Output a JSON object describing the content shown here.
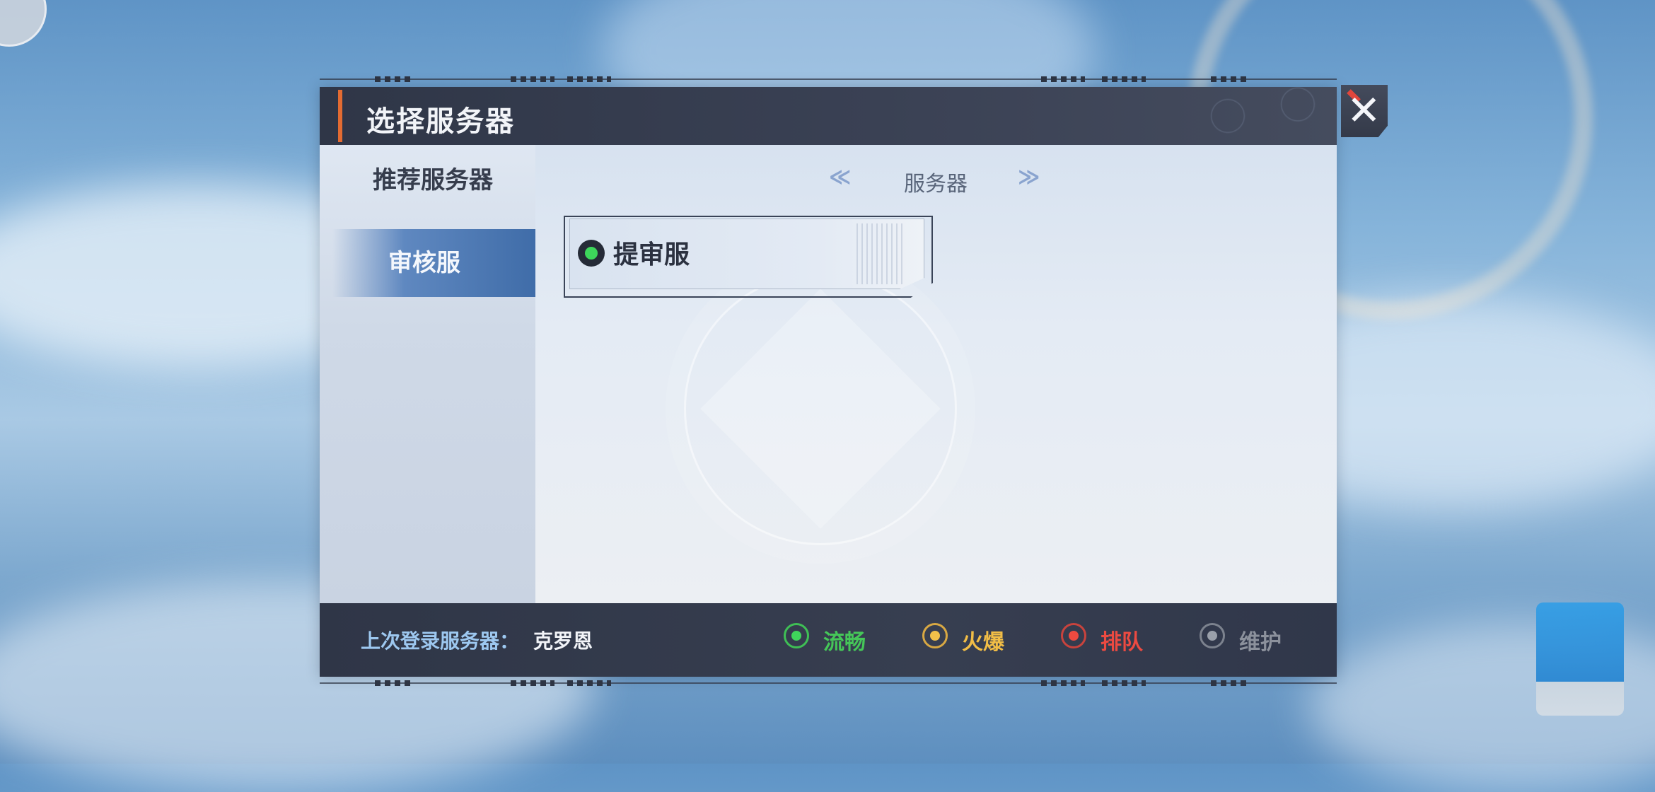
{
  "dialog": {
    "title": "选择服务器",
    "close_symbol": "✕"
  },
  "sidebar": {
    "items": [
      {
        "label": "推荐服务器",
        "selected": false
      },
      {
        "label": "审核服",
        "selected": true
      }
    ]
  },
  "main": {
    "header": {
      "prev_symbol": "≪",
      "title": "服务器",
      "next_symbol": "≫"
    },
    "servers": [
      {
        "name": "提审服",
        "status": "流畅",
        "status_color": "#3dd65b"
      }
    ]
  },
  "footer": {
    "last_login_label": "上次登录服务器：",
    "last_login_value": "克罗恩",
    "legend": [
      {
        "label": "流畅",
        "color": "#45c758"
      },
      {
        "label": "火爆",
        "color": "#f1bd46"
      },
      {
        "label": "排队",
        "color": "#ec4a41"
      },
      {
        "label": "维护",
        "color": "#8c919c"
      }
    ]
  },
  "icons": [
    "close-icon",
    "chevron-left-icon",
    "chevron-right-icon",
    "status-dot-icon"
  ],
  "colors": {
    "header_bg": "#2f3647",
    "accent": "#e36b32",
    "selected_tab": "#3f6ca8"
  }
}
